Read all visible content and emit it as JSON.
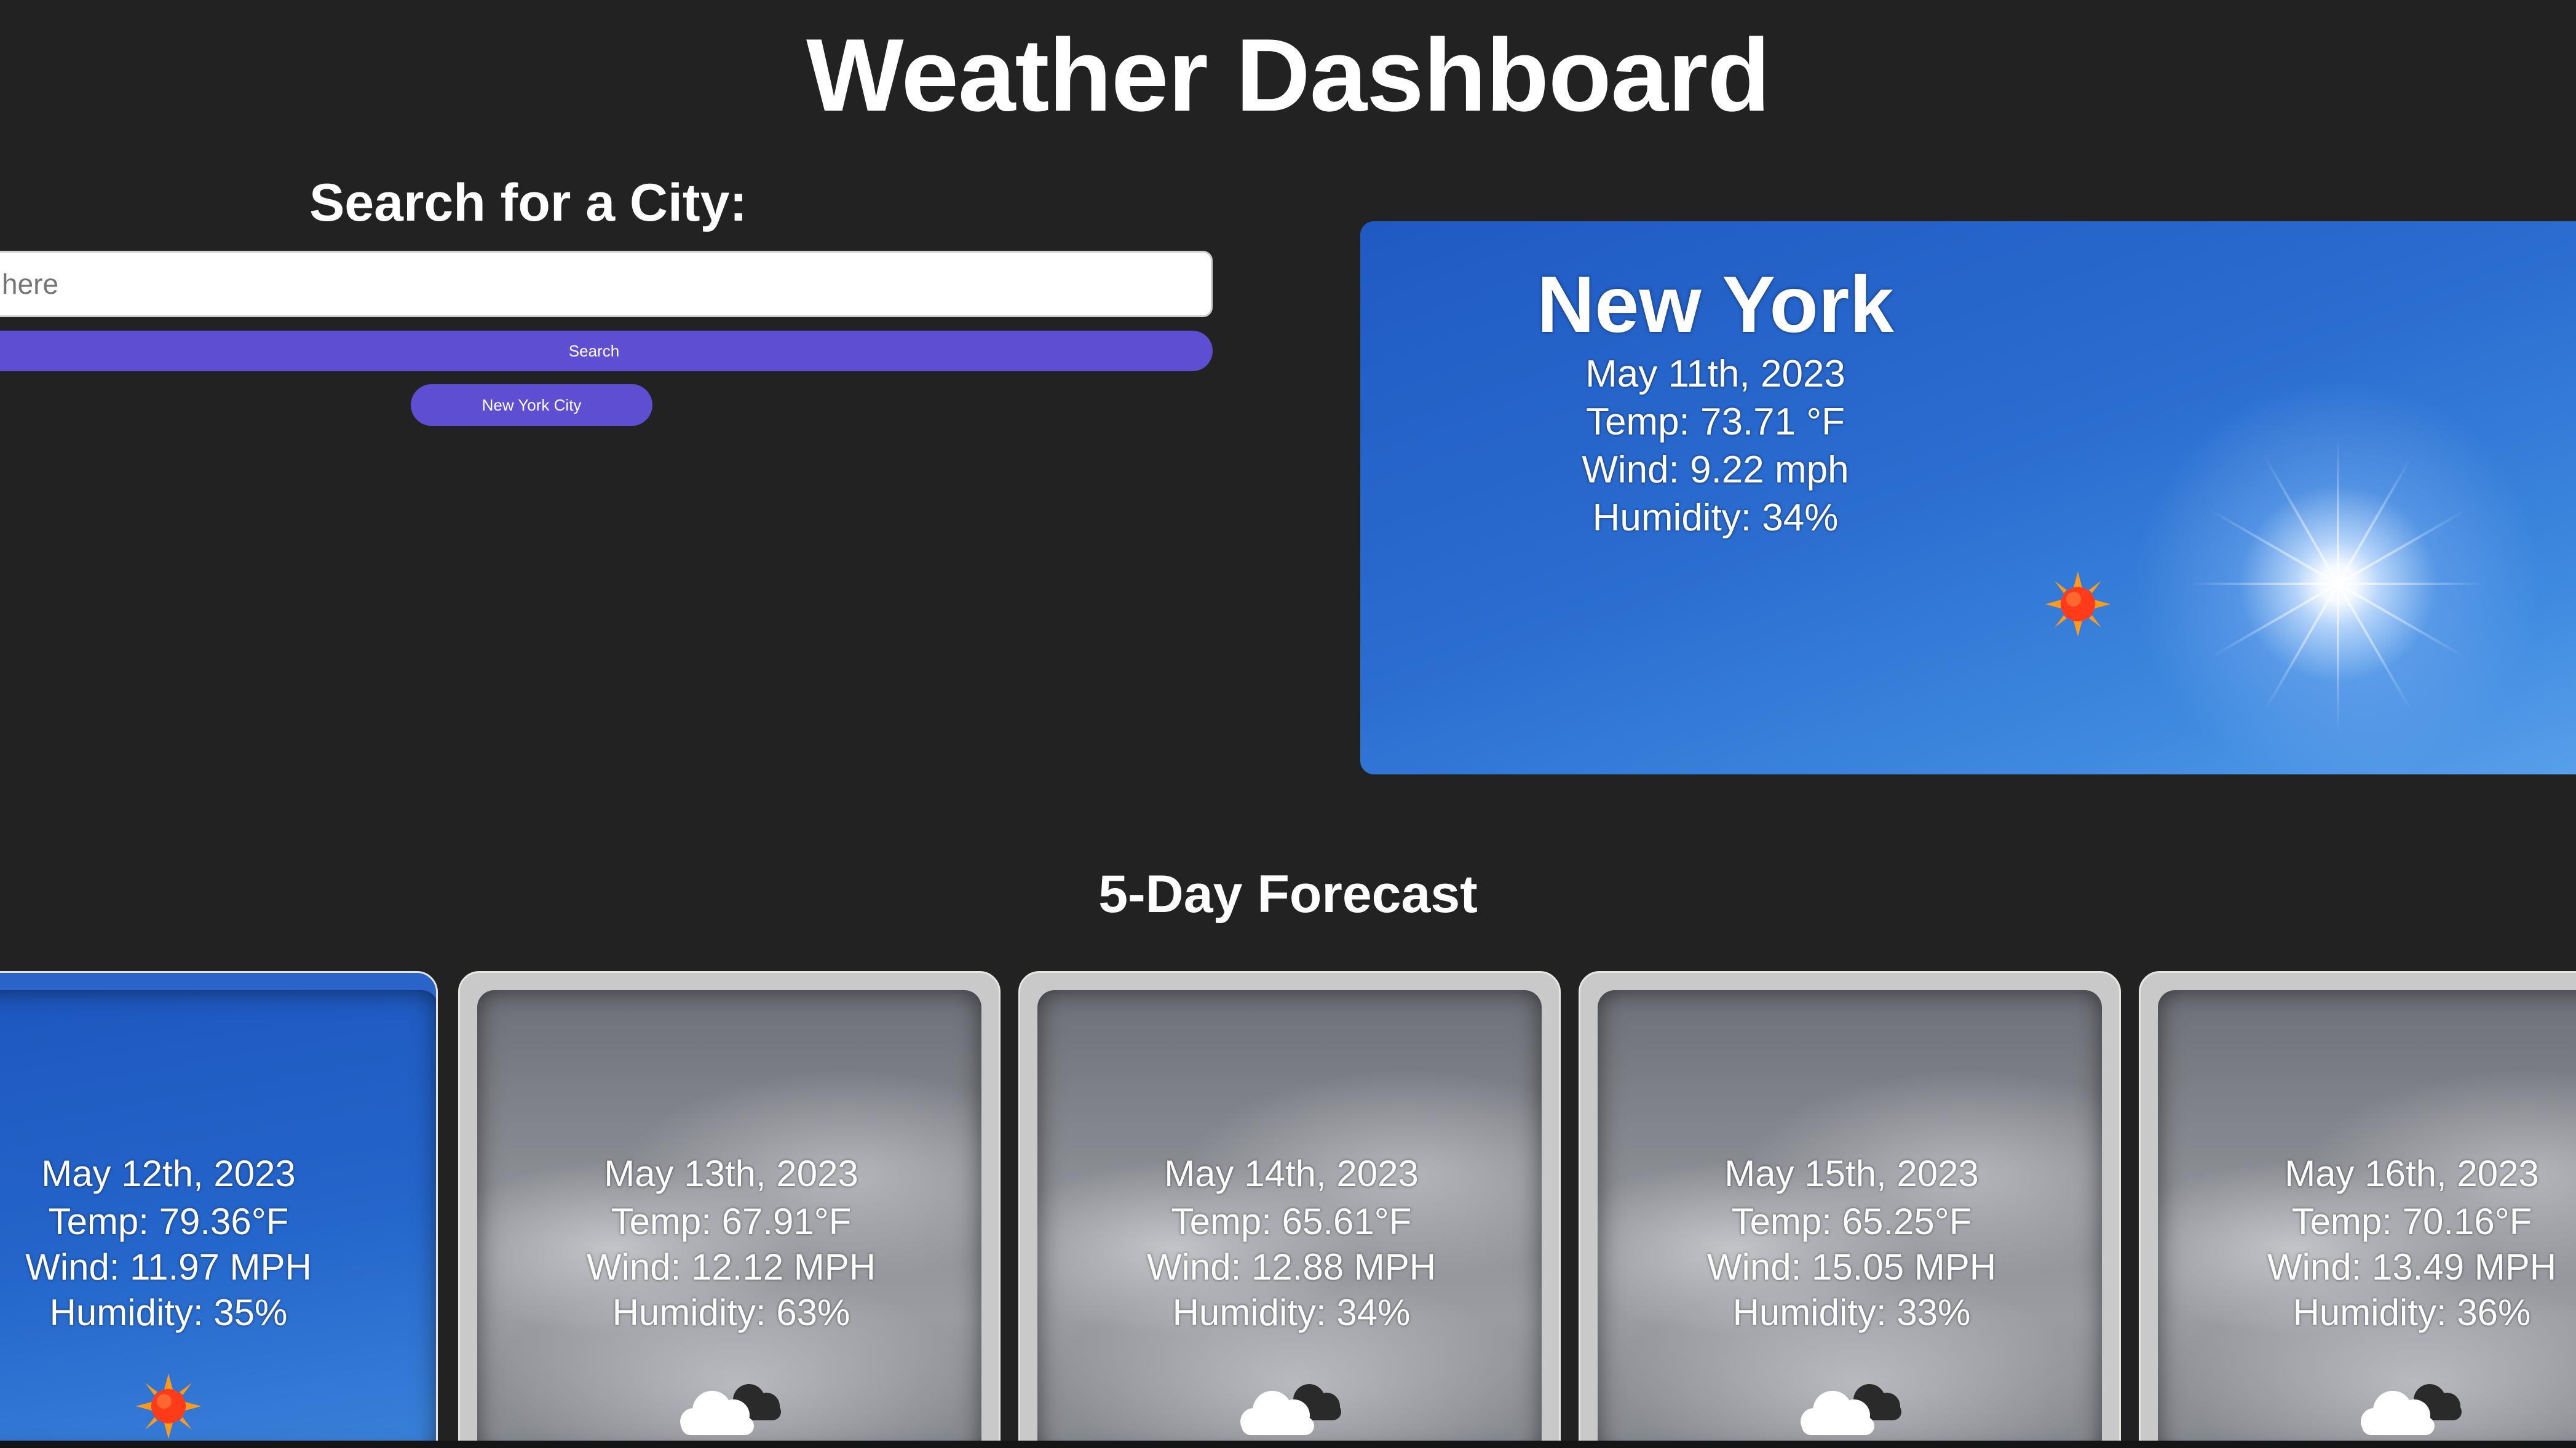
{
  "app": {
    "title": "Weather Dashboard"
  },
  "search": {
    "heading": "Search for a City:",
    "input_placeholder": "Enter a city here",
    "input_visible_fragment": "here",
    "button_label": "Search",
    "history": [
      {
        "label": "New York City"
      }
    ]
  },
  "current": {
    "city": "New York",
    "date": "May 11th, 2023",
    "temp": "Temp: 73.71 °F",
    "wind": "Wind: 9.22 mph",
    "humidity": "Humidity: 34%",
    "icon": "sun-icon"
  },
  "forecast": {
    "heading": "5-Day Forecast",
    "days": [
      {
        "date": "May 12th, 2023",
        "temp": "Temp: 79.36°F",
        "wind": "Wind: 11.97 MPH",
        "humidity": "Humidity: 35%",
        "icon": "sun-icon",
        "condition": "clear"
      },
      {
        "date": "May 13th, 2023",
        "temp": "Temp: 67.91°F",
        "wind": "Wind: 12.12 MPH",
        "humidity": "Humidity: 63%",
        "icon": "cloud-icon",
        "condition": "cloudy"
      },
      {
        "date": "May 14th, 2023",
        "temp": "Temp: 65.61°F",
        "wind": "Wind: 12.88 MPH",
        "humidity": "Humidity: 34%",
        "icon": "cloud-icon",
        "condition": "cloudy"
      },
      {
        "date": "May 15th, 2023",
        "temp": "Temp: 65.25°F",
        "wind": "Wind: 15.05 MPH",
        "humidity": "Humidity: 33%",
        "icon": "cloud-icon",
        "condition": "cloudy"
      },
      {
        "date": "May 16th, 2023",
        "temp": "Temp: 70.16°F",
        "wind": "Wind: 13.49 MPH",
        "humidity": "Humidity: 36%",
        "icon": "cloud-icon",
        "condition": "cloudy"
      }
    ]
  },
  "colors": {
    "background": "#222223",
    "accent_button": "#5e4fd2",
    "sky_blue": "#2a6ccf",
    "cloud_gray": "#8b8d94",
    "text": "#ffffff"
  }
}
